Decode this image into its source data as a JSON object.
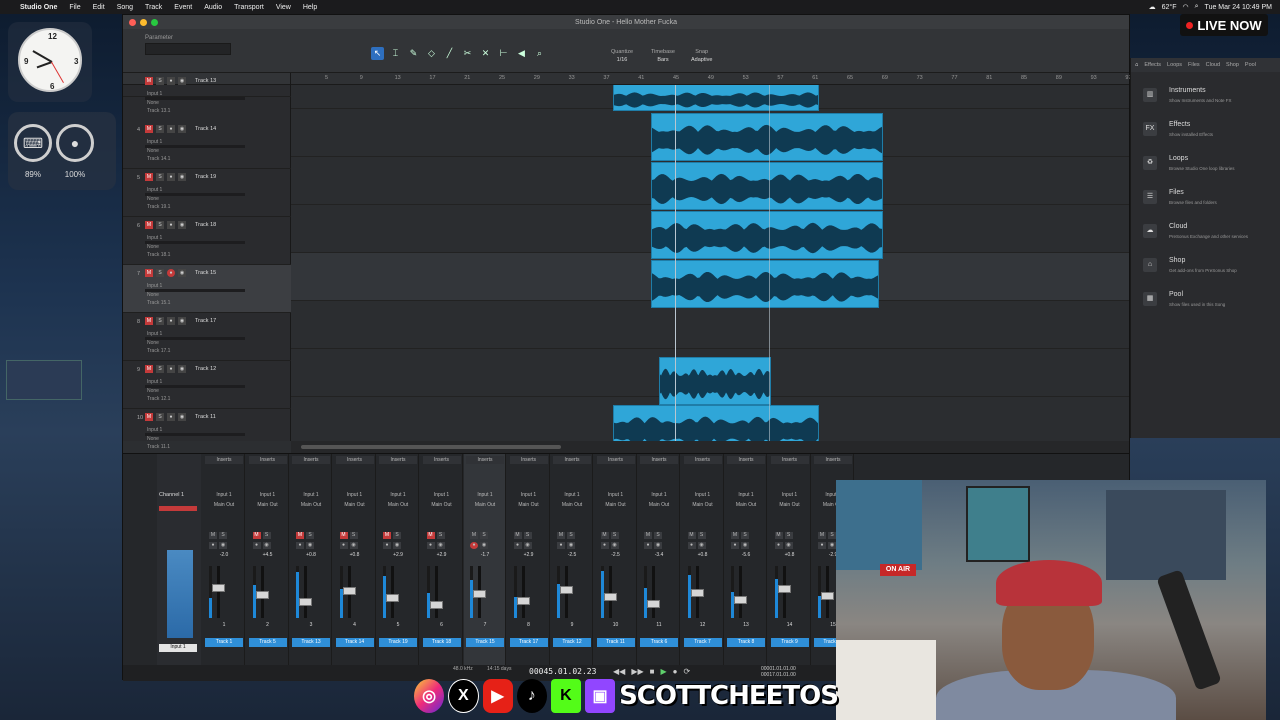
{
  "menubar": {
    "app": "Studio One",
    "items": [
      "File",
      "Edit",
      "Song",
      "Track",
      "Event",
      "Audio",
      "Transport",
      "View",
      "Help"
    ],
    "temp": "62°F",
    "datetime": "Tue Mar 24  10:49 PM"
  },
  "widgets": {
    "battery1": "89%",
    "battery2": "100%"
  },
  "window": {
    "title": "Studio One - Hello Mother Fucka",
    "parameter_label": "Parameter",
    "quantize_label": "Quantize",
    "quantize_value": "1/16",
    "timebase_label": "Timebase",
    "timebase_value": "Bars",
    "snap_label": "Snap",
    "snap_value": "Adaptive"
  },
  "ruler": [
    "5",
    "9",
    "13",
    "17",
    "21",
    "25",
    "29",
    "33",
    "37",
    "41",
    "45",
    "49",
    "53",
    "57",
    "61",
    "65",
    "69",
    "73",
    "77",
    "81",
    "85",
    "89",
    "93",
    "97"
  ],
  "tracks": [
    {
      "num": "",
      "name": "Track 13",
      "input": "Input 1",
      "none": "None",
      "sub": "Track 13.1"
    },
    {
      "num": "4",
      "name": "Track 14",
      "input": "Input 1",
      "none": "None",
      "sub": "Track 14.1"
    },
    {
      "num": "5",
      "name": "Track 19",
      "input": "Input 1",
      "none": "None",
      "sub": "Track 19.1"
    },
    {
      "num": "6",
      "name": "Track 18",
      "input": "Input 1",
      "none": "None",
      "sub": "Track 18.1"
    },
    {
      "num": "7",
      "name": "Track 15",
      "input": "Input 1",
      "none": "None",
      "sub": "Track 15.1"
    },
    {
      "num": "8",
      "name": "Track 17",
      "input": "Input 1",
      "none": "None",
      "sub": "Track 17.1"
    },
    {
      "num": "9",
      "name": "Track 12",
      "input": "Input 1",
      "none": "None",
      "sub": "Track 12.1"
    },
    {
      "num": "10",
      "name": "Track 11",
      "input": "Input 1",
      "none": "None",
      "sub": "Track 11.1"
    }
  ],
  "browser": {
    "tabs": [
      "Effects",
      "Loops",
      "Files",
      "Cloud",
      "Shop",
      "Pool"
    ],
    "items": [
      {
        "icon": "▥",
        "title": "Instruments",
        "desc": "Show Instruments and Note FX"
      },
      {
        "icon": "FX",
        "title": "Effects",
        "desc": "Show installed Effects"
      },
      {
        "icon": "♻",
        "title": "Loops",
        "desc": "Browse Studio One loop libraries"
      },
      {
        "icon": "☰",
        "title": "Files",
        "desc": "Browse files and folders"
      },
      {
        "icon": "☁",
        "title": "Cloud",
        "desc": "PreSonus Exchange and other services"
      },
      {
        "icon": "⌂",
        "title": "Shop",
        "desc": "Get add-ons from PreSonus Shop"
      },
      {
        "icon": "▦",
        "title": "Pool",
        "desc": "Show files used in this Song"
      }
    ]
  },
  "mixer": {
    "inserts_label": "Inserts",
    "channel_label": "Channel 1",
    "input_label": "Input 1",
    "output_label": "Main Out",
    "channel_name": "Input 1",
    "strips": [
      {
        "db": "-2.0",
        "name": "Track 1",
        "num": "1",
        "mute": false,
        "rec": false
      },
      {
        "db": "+4.5",
        "name": "Track 5",
        "num": "2",
        "mute": true,
        "rec": false
      },
      {
        "db": "+0.8",
        "name": "Track 13",
        "num": "3",
        "mute": true,
        "rec": false
      },
      {
        "db": "+0.8",
        "name": "Track 14",
        "num": "4",
        "mute": true,
        "rec": false
      },
      {
        "db": "+2.9",
        "name": "Track 19",
        "num": "5",
        "mute": true,
        "rec": false
      },
      {
        "db": "+2.9",
        "name": "Track 18",
        "num": "6",
        "mute": true,
        "rec": false
      },
      {
        "db": "-1.7",
        "name": "Track 15",
        "num": "7",
        "mute": false,
        "rec": true
      },
      {
        "db": "+2.9",
        "name": "Track 17",
        "num": "8",
        "mute": false,
        "rec": false
      },
      {
        "db": "-2.5",
        "name": "Track 12",
        "num": "9",
        "mute": false,
        "rec": false
      },
      {
        "db": "-2.5",
        "name": "Track 11",
        "num": "10",
        "mute": false,
        "rec": false
      },
      {
        "db": "-3.4",
        "name": "Track 6",
        "num": "11",
        "mute": false,
        "rec": false
      },
      {
        "db": "+0.8",
        "name": "Track 7",
        "num": "12",
        "mute": false,
        "rec": false
      },
      {
        "db": "-5.6",
        "name": "Track 8",
        "num": "13",
        "mute": false,
        "rec": false
      },
      {
        "db": "+0.8",
        "name": "Track 9",
        "num": "14",
        "mute": false,
        "rec": false
      },
      {
        "db": "-2.9",
        "name": "Track 10",
        "num": "15",
        "mute": false,
        "rec": false
      }
    ]
  },
  "transport": {
    "sample_rate": "48.0 kHz",
    "record_time": "14:15 days",
    "timecode": "00045.01.02.23",
    "loop_start": "00001.01.01.00",
    "loop_end": "00017.01.01.00"
  },
  "overlay": {
    "live_label": "LIVE NOW",
    "on_air": "ON AIR",
    "handle": "SCOTTCHEETOS"
  },
  "colors": {
    "clip": "#2fa6d8",
    "mute": "#c43a3a",
    "accent": "#2e6fbf"
  }
}
